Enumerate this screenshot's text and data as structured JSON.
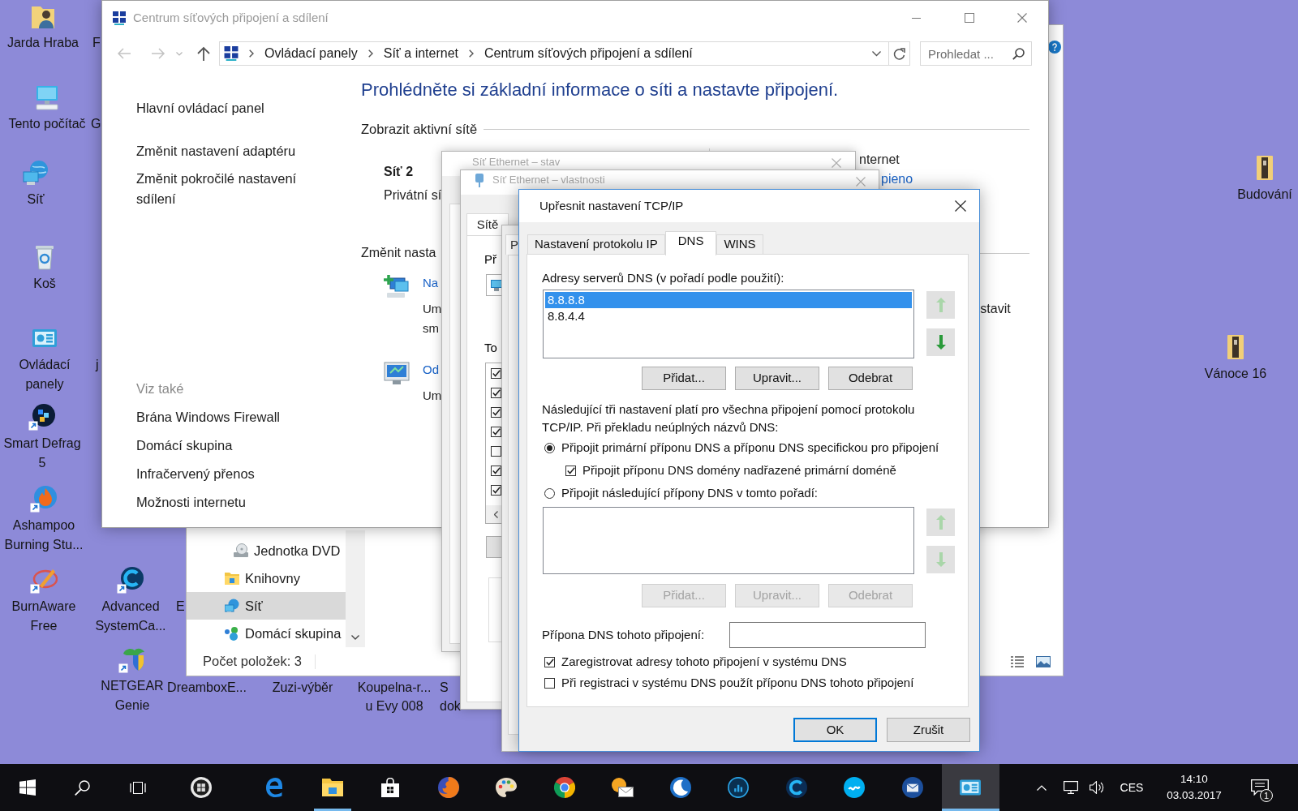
{
  "desktop": {
    "shortcuts": [
      {
        "label": "Jarda Hraba",
        "kind": "user"
      },
      {
        "label": "Tento počítač",
        "kind": "computer"
      },
      {
        "label": "Síť",
        "kind": "network"
      },
      {
        "label": "Koš",
        "kind": "bin"
      },
      {
        "label": "Ovládací panely",
        "kind": "panel"
      },
      {
        "label": "Smart Defrag 5",
        "kind": "defrag"
      },
      {
        "label": "Ashampoo Burning Stu...",
        "kind": "burn"
      },
      {
        "label": "BurnAware Free",
        "kind": "burnaware"
      },
      {
        "label": "Advanced SystemCa...",
        "kind": "care"
      },
      {
        "label": "NETGEAR Genie",
        "kind": "netgear"
      },
      {
        "label": "DreamboxE...",
        "kind": "label"
      },
      {
        "label": "Zuzi-výběr",
        "kind": "label"
      },
      {
        "label": "Koupelna-r... u Evy 008",
        "kind": "label"
      },
      {
        "label": "Budování",
        "kind": "binder"
      },
      {
        "label": "Vánoce 16",
        "kind": "binder"
      }
    ],
    "clipped_labels": [
      "F",
      "G",
      "j",
      "E",
      "S dok"
    ]
  },
  "explorer_window": {
    "nav_items": [
      {
        "label": "Jednotka DVD",
        "kind": "drive",
        "selected": false
      },
      {
        "label": "Knihovny",
        "kind": "libraries",
        "selected": false
      },
      {
        "label": "Síť",
        "kind": "network",
        "selected": true
      },
      {
        "label": "Domácí skupina",
        "kind": "homegroup",
        "selected": false
      }
    ],
    "status_bar": "Počet položek: 3"
  },
  "control_panel_window": {
    "title": "Centrum síťových připojení a sdílení",
    "breadcrumb": [
      "Ovládací panely",
      "Síť a internet",
      "Centrum síťových připojení a sdílení"
    ],
    "search": {
      "placeholder": "Prohledat ..."
    },
    "sidebar": {
      "links": [
        "Hlavní ovládací panel",
        "Změnit nastavení adaptéru",
        "Změnit pokročilé nastavení sdílení"
      ],
      "see_also_heading": "Viz také",
      "see_also": [
        "Brána Windows Firewall",
        "Domácí skupina",
        "Infračervený přenos",
        "Možnosti internetu"
      ]
    },
    "heading": "Prohlédněte si základní informace o síti a nastavte připojení.",
    "active_networks_heading": "Zobrazit aktivní sítě",
    "network": {
      "name": "Síť 2",
      "category": "Privátní sí",
      "access_type": "nternet",
      "connection": "pieno"
    },
    "change_heading": "Změnit nasta",
    "tasks": [
      {
        "kind": "setup",
        "link": "Na",
        "description": [
          "Um",
          "sm"
        ],
        "description_tail": "stavit"
      },
      {
        "kind": "troubleshoot",
        "link": "Od",
        "description": [
          "Um"
        ]
      }
    ]
  },
  "status_dialog": {
    "title": "Síť Ethernet – stav"
  },
  "properties_dialog": {
    "title": "Síť Ethernet – vlastnosti",
    "tab": "Sítě",
    "connect_using_label": "Př",
    "items_label": "To",
    "items": [
      {
        "checked": true
      },
      {
        "checked": true
      },
      {
        "checked": true
      },
      {
        "checked": true
      },
      {
        "checked": false
      },
      {
        "checked": true
      },
      {
        "checked": true
      }
    ]
  },
  "ipv4_dialog": {
    "tab": "P"
  },
  "tcpip_dialog": {
    "title": "Upřesnit nastavení TCP/IP",
    "tabs": [
      {
        "label": "Nastavení protokolu IP",
        "selected": false
      },
      {
        "label": "DNS",
        "selected": true
      },
      {
        "label": "WINS",
        "selected": false
      }
    ],
    "dns_servers": {
      "label": "Adresy serverů DNS (v pořadí podle použití):",
      "items": [
        {
          "text": "8.8.8.8",
          "selected": true
        },
        {
          "text": "8.8.4.4",
          "selected": false
        }
      ],
      "move_up": {
        "disabled": true
      },
      "move_down": {
        "disabled": false
      },
      "buttons": [
        {
          "label": "Přidat...",
          "disabled": false
        },
        {
          "label": "Upravit...",
          "disabled": false
        },
        {
          "label": "Odebrat",
          "disabled": false
        }
      ]
    },
    "note": "Následující tři nastavení platí pro všechna připojení pomocí protokolu TCP/IP. Při překladu neúplných názvů DNS:",
    "options": [
      {
        "kind": "radio",
        "label": "Připojit primární příponu DNS a příponu DNS specifickou pro připojení",
        "selected": true
      },
      {
        "kind": "checkbox",
        "label": "Připojit příponu DNS domény nadřazené primární doméně",
        "checked": true
      },
      {
        "kind": "radio",
        "label": "Připojit následující přípony DNS v tomto pořadí:",
        "selected": false
      }
    ],
    "suffixes": {
      "move_up": {
        "disabled": true
      },
      "move_down": {
        "disabled": true
      },
      "buttons": [
        {
          "label": "Přidat...",
          "disabled": true
        },
        {
          "label": "Upravit...",
          "disabled": true
        },
        {
          "label": "Odebrat",
          "disabled": true
        }
      ]
    },
    "connection_suffix": {
      "label": "Přípona DNS tohoto připojení:"
    },
    "registration": [
      {
        "label": "Zaregistrovat adresy tohoto připojení v systému DNS",
        "checked": true
      },
      {
        "label": "Při registraci v systému DNS použít příponu DNS tohoto připojení",
        "checked": false
      }
    ],
    "footer_buttons": [
      {
        "label": "OK",
        "default": true
      },
      {
        "label": "Zrušit",
        "default": false
      }
    ]
  },
  "taskbar": {
    "buttons": [
      {
        "kind": "start"
      },
      {
        "kind": "search"
      },
      {
        "kind": "task-view"
      }
    ],
    "apps": [
      {
        "kind": "orb",
        "running": false,
        "active": false
      },
      {
        "kind": "edge",
        "running": false,
        "active": false
      },
      {
        "kind": "explorer",
        "running": true,
        "active": false
      },
      {
        "kind": "store",
        "running": false,
        "active": false
      },
      {
        "kind": "firefox",
        "running": false,
        "active": false
      },
      {
        "kind": "paint",
        "running": false,
        "active": false
      },
      {
        "kind": "chrome",
        "running": false,
        "active": false
      },
      {
        "kind": "mail",
        "running": false,
        "active": false
      },
      {
        "kind": "moon",
        "running": false,
        "active": false
      },
      {
        "kind": "dots",
        "running": false,
        "active": false
      },
      {
        "kind": "care",
        "running": false,
        "active": false
      },
      {
        "kind": "skype",
        "running": false,
        "active": false
      },
      {
        "kind": "thunderbird",
        "running": false,
        "active": false
      },
      {
        "kind": "panel",
        "running": true,
        "active": true
      }
    ],
    "tray": {
      "language": "CES",
      "time": "14:10",
      "date": "03.03.2017",
      "notification_count": "1"
    }
  }
}
